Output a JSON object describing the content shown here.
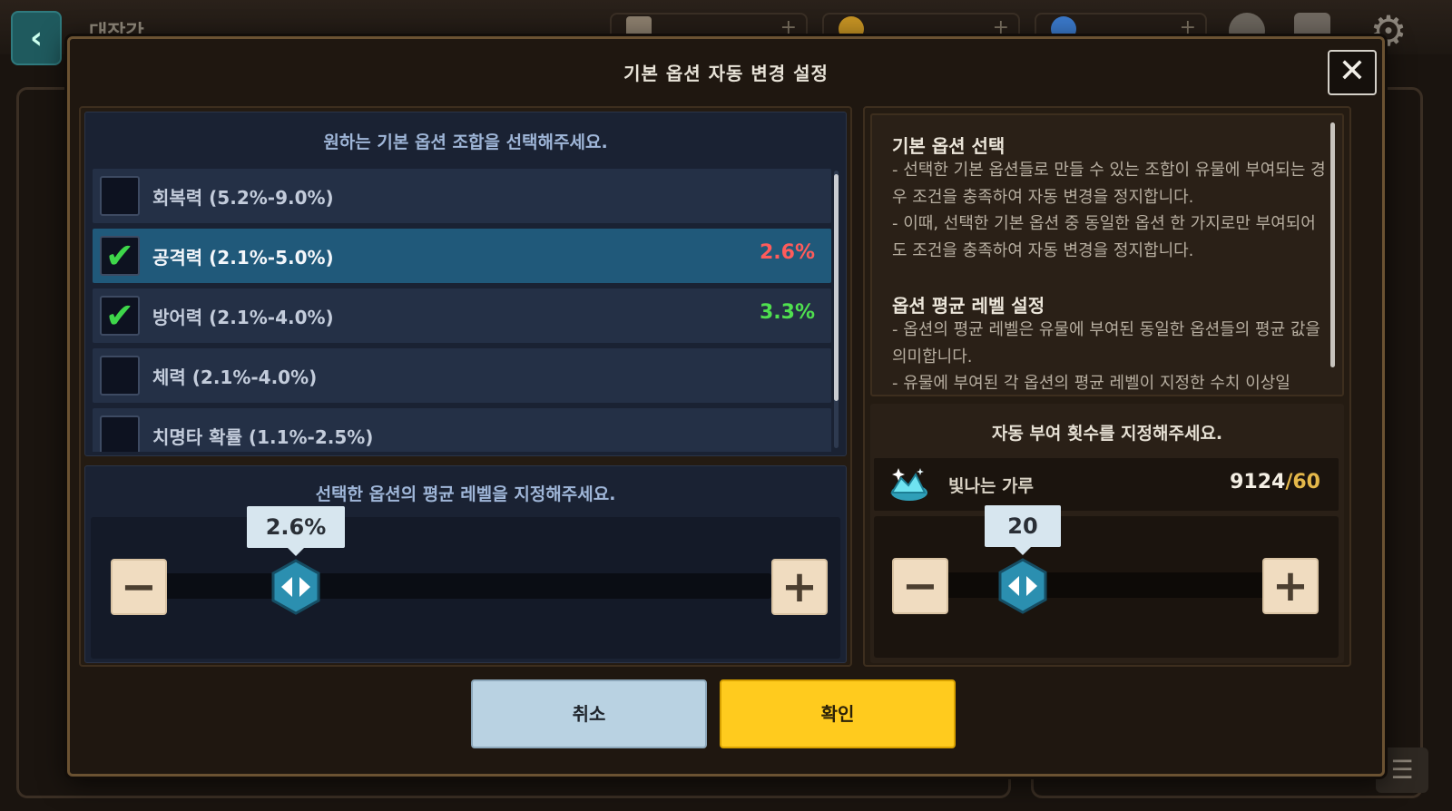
{
  "background": {
    "title": "대장간",
    "back_icon": "‹",
    "settings_icon": "⚙",
    "filter_icon": "☰"
  },
  "modal": {
    "title": "기본 옵션 자동 변경 설정",
    "close_icon": "✕"
  },
  "options": {
    "header": "원하는 기본 옵션 조합을 선택해주세요.",
    "items": [
      {
        "label": "회복력 (5.2%-9.0%)",
        "checked": false,
        "value": ""
      },
      {
        "label": "공격력 (2.1%-5.0%)",
        "checked": true,
        "value": "2.6%",
        "value_color": "red"
      },
      {
        "label": "방어력 (2.1%-4.0%)",
        "checked": true,
        "value": "3.3%",
        "value_color": "green"
      },
      {
        "label": "체력 (2.1%-4.0%)",
        "checked": false,
        "value": ""
      },
      {
        "label": "치명타 확률 (1.1%-2.5%)",
        "checked": false,
        "value": ""
      }
    ]
  },
  "level": {
    "header": "선택한 옵션의 평균 레벨을 지정해주세요.",
    "value": "2.6%",
    "minus": "−",
    "plus": "+"
  },
  "info": {
    "section1_title": "기본 옵션 선택",
    "section1_text": "- 선택한 기본 옵션들로 만들 수 있는 조합이 유물에 부여되는 경우 조건을 충족하여 자동 변경을 정지합니다.\n- 이때, 선택한 기본 옵션 중 동일한 옵션 한 가지로만 부여되어도 조건을 충족하여 자동 변경을 정지합니다.",
    "section2_title": "옵션 평균 레벨 설정",
    "section2_text": "- 옵션의 평균 레벨은 유물에 부여된 동일한 옵션들의 평균 값을 의미합니다.\n- 유물에 부여된 각 옵션의 평균 레벨이 지정한 수치 이상일"
  },
  "count": {
    "header": "자동 부여 횟수를 지정해주세요.",
    "material_name": "빛나는 가루",
    "owned": "9124",
    "required": "/60",
    "value": "20",
    "minus": "−",
    "plus": "+"
  },
  "buttons": {
    "cancel": "취소",
    "confirm": "확인"
  },
  "colors": {
    "accent_yellow": "#ffcb1e",
    "selected_row": "#20597a",
    "value_red": "#ff5b5b",
    "value_green": "#4fe04f"
  }
}
